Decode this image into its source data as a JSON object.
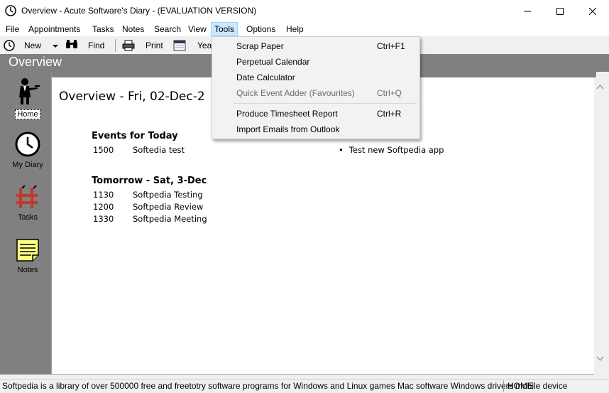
{
  "window": {
    "title": "Overview - Acute Software's Diary - (EVALUATION VERSION)",
    "controls": {
      "minimize": "—",
      "maximize": "☐",
      "close": "✕"
    }
  },
  "menubar": {
    "items": [
      "File",
      "Appointments",
      "Tasks",
      "Notes",
      "Search",
      "View",
      "Tools",
      "Options",
      "Help"
    ],
    "active": "Tools"
  },
  "toolbar": {
    "new_label": "New",
    "find_label": "Find",
    "print_label": "Print",
    "year_label": "Year"
  },
  "header": {
    "title": "Overview"
  },
  "sidebar": {
    "items": [
      {
        "label": "Home",
        "icon": "butler-icon",
        "selected": true
      },
      {
        "label": "My Diary",
        "icon": "clock-icon",
        "selected": false
      },
      {
        "label": "Tasks",
        "icon": "tasks-icon",
        "selected": false
      },
      {
        "label": "Notes",
        "icon": "note-icon",
        "selected": false
      }
    ]
  },
  "main": {
    "title": "Overview - Fri, 02-Dec-2",
    "today": {
      "heading": "Events for Today",
      "events": [
        {
          "time": "1500",
          "text": "Softedia test"
        }
      ]
    },
    "tomorrow": {
      "heading": "Tomorrow - Sat, 3-Dec",
      "events": [
        {
          "time": "1130",
          "text": "Softpedia Testing"
        },
        {
          "time": "1200",
          "text": "Softpedia Review"
        },
        {
          "time": "1330",
          "text": "Softpedia Meeting"
        }
      ]
    },
    "tasks": {
      "bullet": "•",
      "items": [
        "Test new Softpedia app"
      ]
    }
  },
  "tools_menu": {
    "items": [
      {
        "label": "Scrap Paper",
        "shortcut": "Ctrl+F1",
        "disabled": false
      },
      {
        "label": "Perpetual Calendar",
        "shortcut": "",
        "disabled": false
      },
      {
        "label": "Date Calculator",
        "shortcut": "",
        "disabled": false
      },
      {
        "label": "Quick Event Adder (Favourites)",
        "shortcut": "Ctrl+Q",
        "disabled": true
      },
      {
        "label": "Produce Timesheet Report",
        "shortcut": "Ctrl+R",
        "disabled": false
      },
      {
        "label": "Import Emails from Outlook",
        "shortcut": "",
        "disabled": false
      }
    ]
  },
  "statusbar": {
    "message": "Softpedia is a library of over 500000 free and freetotry software programs for Windows and Linux games Mac software Windows drivers mobile device",
    "section": "HOME"
  },
  "colors": {
    "menu_highlight": "#cce8ff",
    "header_band": "#808080",
    "note_yellow": "#ffff80"
  }
}
